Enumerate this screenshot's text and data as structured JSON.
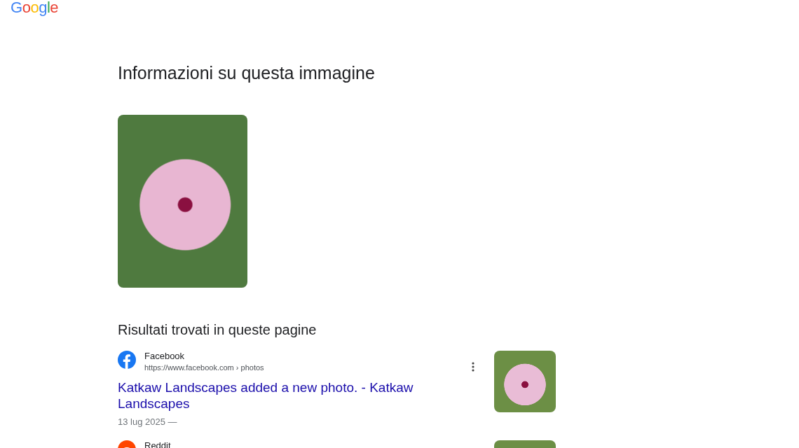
{
  "logo": "Google",
  "heading": "Informazioni su questa immagine",
  "section_title": "Risultati trovati in queste pagine",
  "results": [
    {
      "kind": "facebook",
      "source": "Facebook",
      "url": "https://www.facebook.com › photos",
      "title": "Katkaw Landscapes added a new photo. - Katkaw Landscapes",
      "date": "13 lug 2025 —"
    },
    {
      "kind": "reddit",
      "source": "Reddit"
    }
  ]
}
